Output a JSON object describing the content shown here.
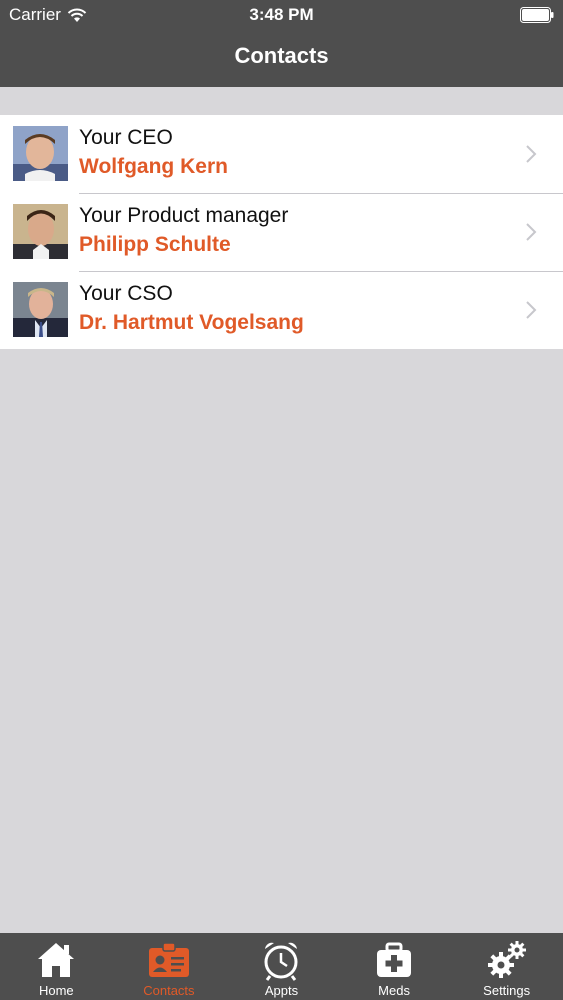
{
  "status_bar": {
    "carrier": "Carrier",
    "time": "3:48 PM"
  },
  "nav": {
    "title": "Contacts"
  },
  "contacts": [
    {
      "role": "Your CEO",
      "name": "Wolfgang Kern",
      "avatar_icon": "person-photo"
    },
    {
      "role": "Your Product manager",
      "name": "Philipp Schulte",
      "avatar_icon": "person-photo"
    },
    {
      "role": "Your CSO",
      "name": "Dr. Hartmut Vogelsang",
      "avatar_icon": "person-photo"
    }
  ],
  "tabs": [
    {
      "label": "Home",
      "icon": "house-icon",
      "active": false
    },
    {
      "label": "Contacts",
      "icon": "contact-card-icon",
      "active": true
    },
    {
      "label": "Appts",
      "icon": "alarm-clock-icon",
      "active": false
    },
    {
      "label": "Meds",
      "icon": "first-aid-kit-icon",
      "active": false
    },
    {
      "label": "Settings",
      "icon": "gears-icon",
      "active": false
    }
  ],
  "colors": {
    "header_bg": "#4e4e4e",
    "accent": "#e05a28",
    "page_bg": "#d8d7da"
  }
}
